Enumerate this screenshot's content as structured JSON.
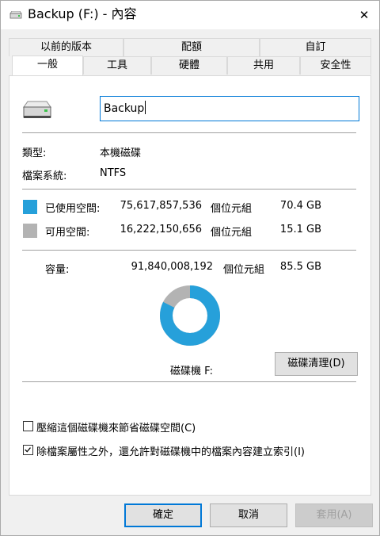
{
  "window": {
    "title": "Backup (F:) - 內容",
    "close_glyph": "✕"
  },
  "tabs_row1": [
    "以前的版本",
    "配額",
    "自訂"
  ],
  "tabs_row2": [
    "一般",
    "工具",
    "硬體",
    "共用",
    "安全性"
  ],
  "general": {
    "drive_name": "Backup",
    "type_label": "類型:",
    "type_value": "本機磁碟",
    "fs_label": "檔案系統:",
    "fs_value": "NTFS",
    "used": {
      "label": "已使用空間:",
      "bytes": "75,617,857,536",
      "unit": "個位元組",
      "size": "70.4 GB",
      "color": "#26a0da"
    },
    "free": {
      "label": "可用空間:",
      "bytes": "16,222,150,656",
      "unit": "個位元組",
      "size": "15.1 GB",
      "color": "#b3b3b3"
    },
    "capacity": {
      "label": "容量:",
      "bytes": "91,840,008,192",
      "unit": "個位元組",
      "size": "85.5 GB"
    },
    "used_fraction": 0.8234,
    "drive_label": "磁碟機 F:",
    "cleanup_button": "磁碟清理(D)",
    "compress_label": "壓縮這個磁碟機來節省磁碟空間(C)",
    "compress_checked": false,
    "index_label": "除檔案屬性之外，還允許對磁碟機中的檔案內容建立索引(I)",
    "index_checked": true
  },
  "buttons": {
    "ok": "確定",
    "cancel": "取消",
    "apply": "套用(A)"
  }
}
